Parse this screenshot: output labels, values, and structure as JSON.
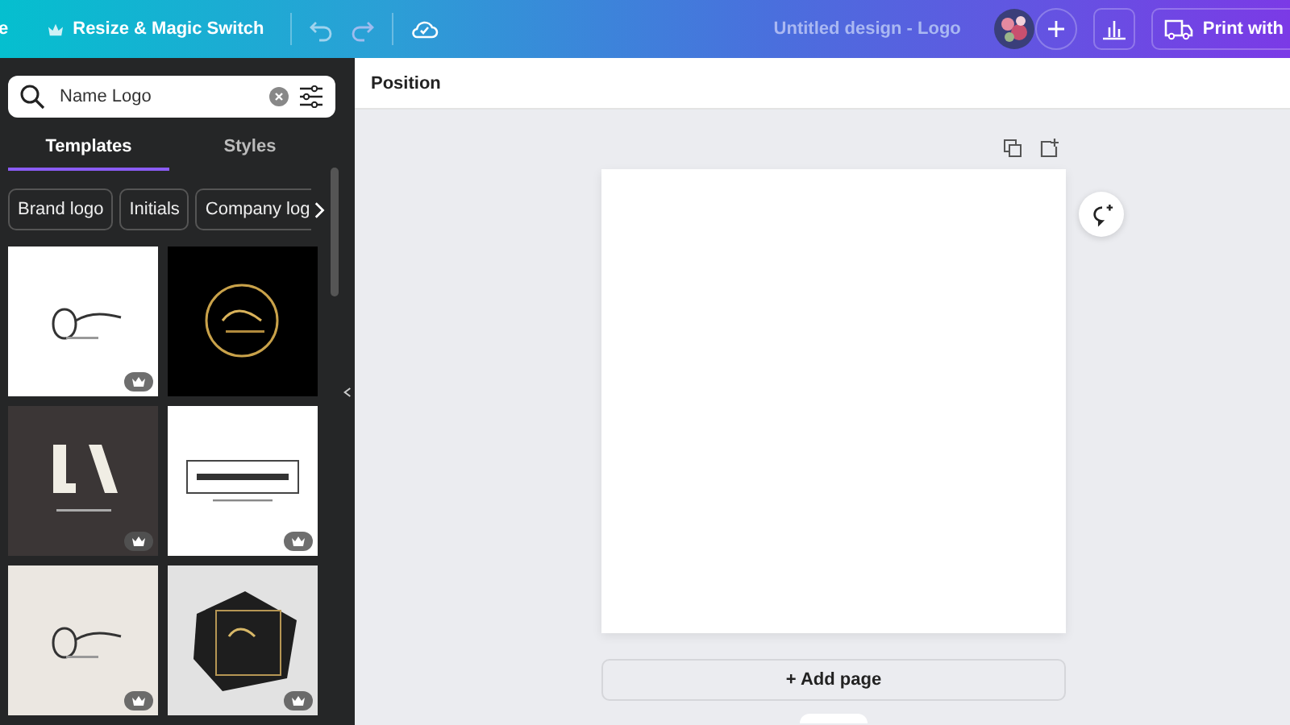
{
  "topbar": {
    "cut_menu": "e",
    "resize_button": "Resize & Magic Switch",
    "design_title": "Untitled design - Logo",
    "print_button": "Print with"
  },
  "search": {
    "value": "Name Logo"
  },
  "tabs": [
    {
      "label": "Templates",
      "selected": true
    },
    {
      "label": "Styles",
      "selected": false
    }
  ],
  "chips": [
    "Brand logo",
    "Initials",
    "Company log"
  ],
  "templates": [
    {
      "kind": "picture",
      "premium": true
    },
    {
      "kind": "picture",
      "premium": false
    },
    {
      "kind": "picture",
      "premium": true
    },
    {
      "kind": "picture",
      "premium": true
    },
    {
      "kind": "picture",
      "premium": true
    },
    {
      "kind": "picture",
      "premium": true
    }
  ],
  "toolbar": {
    "position_button": "Position"
  },
  "canvas": {
    "add_page_button": "+ Add page"
  }
}
